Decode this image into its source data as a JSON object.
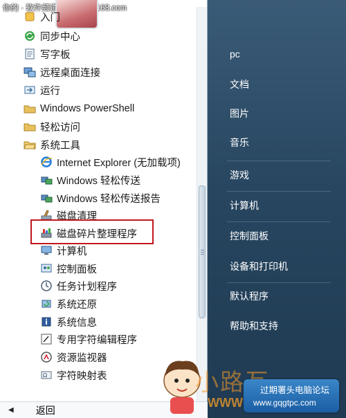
{
  "watermark": {
    "top": "你的 · 软件频道 software.it168.com",
    "brand": "小路互",
    "badge_line1": "过期署头电脑论坛",
    "badge_line2": "www.gqgtpc.com",
    "www": "WWW"
  },
  "programs": [
    {
      "label": "入门",
      "icon": "getting-started-icon"
    },
    {
      "label": "同步中心",
      "icon": "sync-center-icon"
    },
    {
      "label": "写字板",
      "icon": "wordpad-icon"
    },
    {
      "label": "远程桌面连接",
      "icon": "remote-desktop-icon"
    },
    {
      "label": "运行",
      "icon": "run-icon"
    },
    {
      "label": "Windows PowerShell",
      "icon": "folder-icon"
    },
    {
      "label": "轻松访问",
      "icon": "folder-icon"
    },
    {
      "label": "系统工具",
      "icon": "folder-open-icon"
    },
    {
      "label": "Internet Explorer (无加载项)",
      "icon": "internet-explorer-icon"
    },
    {
      "label": "Windows 轻松传送",
      "icon": "easy-transfer-icon"
    },
    {
      "label": "Windows 轻松传送报告",
      "icon": "easy-transfer-report-icon"
    },
    {
      "label": "磁盘清理",
      "icon": "disk-cleanup-icon"
    },
    {
      "label": "磁盘碎片整理程序",
      "icon": "disk-defragmenter-icon"
    },
    {
      "label": "计算机",
      "icon": "computer-icon"
    },
    {
      "label": "控制面板",
      "icon": "control-panel-icon"
    },
    {
      "label": "任务计划程序",
      "icon": "task-scheduler-icon"
    },
    {
      "label": "系统还原",
      "icon": "system-restore-icon"
    },
    {
      "label": "系统信息",
      "icon": "system-information-icon"
    },
    {
      "label": "专用字符编辑程序",
      "icon": "private-character-editor-icon"
    },
    {
      "label": "资源监视器",
      "icon": "resource-monitor-icon"
    },
    {
      "label": "字符映射表",
      "icon": "character-map-icon"
    }
  ],
  "back_label": "返回",
  "right_menu": [
    "pc",
    "文档",
    "图片",
    "音乐",
    "游戏",
    "计算机",
    "控制面板",
    "设备和打印机",
    "默认程序",
    "帮助和支持"
  ],
  "colors": {
    "highlight": "#c0181d",
    "right_panel": "#284660"
  }
}
